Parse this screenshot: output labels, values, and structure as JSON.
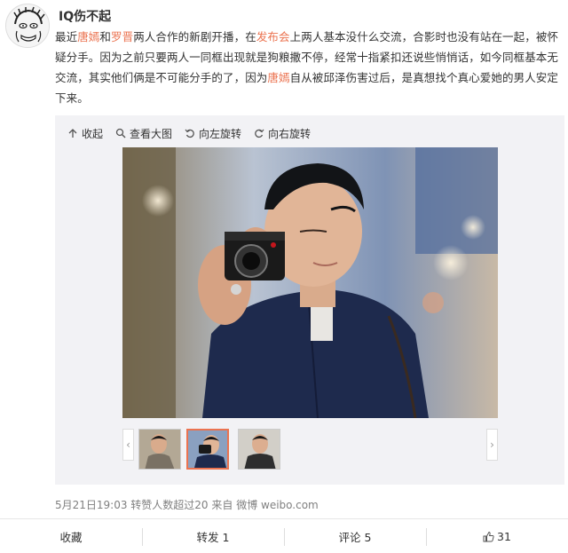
{
  "user": {
    "name": "IQ伤不起"
  },
  "post": {
    "seg1": "最近",
    "name1": "唐嫣",
    "seg2": "和",
    "name2": "罗晋",
    "seg3": "两人合作的新剧开播，在",
    "link1": "发布会",
    "seg4": "上两人基本没什么交流，合影时也没有站在一起，被怀疑分手。因为之前只要两人一同框出现就是狗粮撒不停，经常十指紧扣还说些悄悄话，如今同框基本无交流，其实他们俩是不可能分手的了，因为",
    "name3": "唐嫣",
    "seg5": "自从被邱泽伤害过后，是真想找个真心爱她的男人安定下来。"
  },
  "toolbar": {
    "collapse": "收起",
    "view_large": "查看大图",
    "rotate_left": "向左旋转",
    "rotate_right": "向右旋转"
  },
  "thumbnails": {
    "count": 3,
    "active_index": 1
  },
  "meta": {
    "text": "5月21日19:03 转赞人数超过20 来自 微博 weibo.com"
  },
  "actions": {
    "favorite": "收藏",
    "repost": "转发 1",
    "comment": "评论 5",
    "like_count": "31"
  },
  "colors": {
    "highlight": "#eb7350",
    "meta": "#808080",
    "panel": "#f2f2f5"
  }
}
